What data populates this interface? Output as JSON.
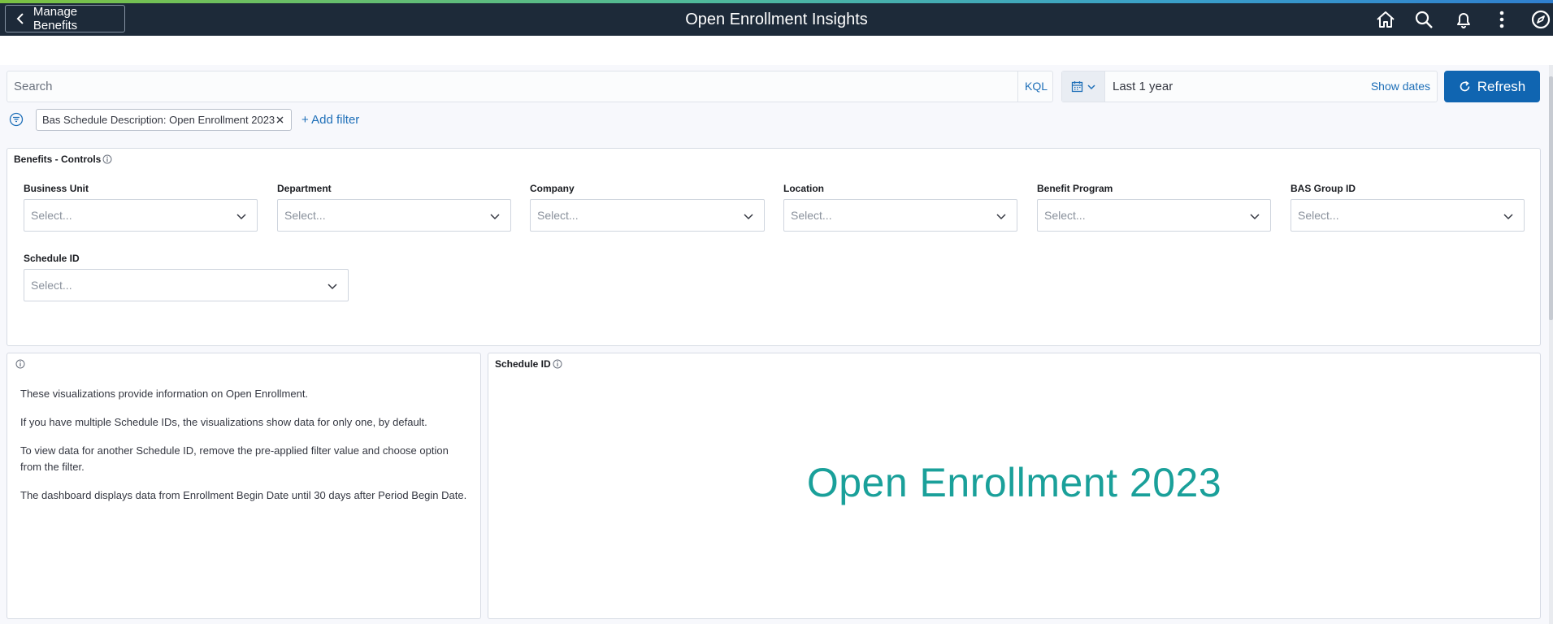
{
  "header": {
    "back_label": "Manage Benefits",
    "title": "Open Enrollment Insights",
    "icons": [
      "home-icon",
      "search-icon",
      "bell-icon",
      "more-vertical-icon",
      "compass-icon"
    ]
  },
  "query_bar": {
    "search_placeholder": "Search",
    "kql_label": "KQL",
    "date_range": "Last 1 year",
    "show_dates_label": "Show dates",
    "refresh_label": "Refresh"
  },
  "filters": {
    "applied": [
      "Bas Schedule Description: Open Enrollment 2023"
    ],
    "add_filter_label": "+ Add filter"
  },
  "controls_panel": {
    "title": "Benefits - Controls",
    "controls": [
      {
        "label": "Business Unit",
        "placeholder": "Select..."
      },
      {
        "label": "Department",
        "placeholder": "Select..."
      },
      {
        "label": "Company",
        "placeholder": "Select..."
      },
      {
        "label": "Location",
        "placeholder": "Select..."
      },
      {
        "label": "Benefit Program",
        "placeholder": "Select..."
      },
      {
        "label": "BAS Group ID",
        "placeholder": "Select..."
      },
      {
        "label": "Schedule ID",
        "placeholder": "Select..."
      }
    ]
  },
  "info_panel": {
    "paragraphs": [
      "These visualizations provide information on Open Enrollment.",
      "If you have multiple Schedule IDs, the visualizations show data for only one, by default.",
      "To view data for another Schedule ID, remove the pre-applied filter value and choose option from the filter.",
      "The dashboard displays data from Enrollment Begin Date until 30 days after Period Begin Date."
    ]
  },
  "metric_panel": {
    "title": "Schedule ID",
    "value": "Open Enrollment 2023"
  },
  "colors": {
    "header_bg": "#1d2a39",
    "accent_blue": "#1065b1",
    "link_blue": "#1e6fb8",
    "metric_teal": "#1aa09a"
  }
}
